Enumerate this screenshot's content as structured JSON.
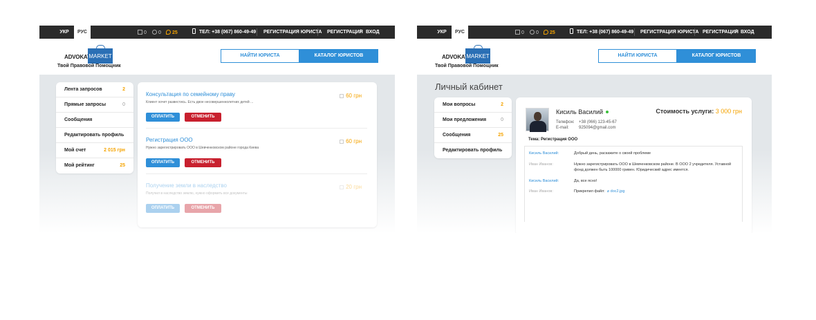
{
  "topbar": {
    "lang_uk": "УКР",
    "lang_ru": "РУС",
    "docs_count": "0",
    "warn_count": "0",
    "msg_count": "25",
    "phone": "ТЕЛ: +38 (067) 860-49-49",
    "register_lawyer": "РЕГИСТРАЦИЯ ЮРИСТА",
    "register": "РЕГИСТРАЦИЯ",
    "slash": "/",
    "login": "ВХОД"
  },
  "header": {
    "logo_advokat": "ADVOKAT",
    "logo_market": "MARKET",
    "tagline": "Твой Правовой Помощник",
    "find_lawyer": "НАЙТИ ЮРИСТА",
    "lawyer_catalog": "КАТАЛОГ ЮРИСТОВ"
  },
  "screen1": {
    "menu": [
      {
        "label": "Лента запросов",
        "count": "2"
      },
      {
        "label": "Прямые запросы",
        "count": "0"
      },
      {
        "label": "Сообщения",
        "count": ""
      },
      {
        "label": "Редактировать профиль",
        "count": ""
      },
      {
        "label": "Мой счет",
        "count": "2 015 грн"
      },
      {
        "label": "Мой рейтинг",
        "count": "25"
      }
    ],
    "requests": [
      {
        "title": "Консультация по семейному праву",
        "desc": "Клиент хочет развестись. Есть двое несовершеннолетних детей ...",
        "price": "60 грн",
        "pay": "ОПЛАТИТЬ",
        "cancel": "ОТМЕНИТЬ"
      },
      {
        "title": "Регистрация ООО",
        "desc": "Нужно зарегистрировать ООО в Шевченковском районе города Киева",
        "price": "60 грн",
        "pay": "ОПЛАТИТЬ",
        "cancel": "ОТМЕНИТЬ"
      },
      {
        "title": "Получение земли в наследство",
        "desc": "Получил в наследство землю, нужно оформить все документы",
        "price": "20 грн",
        "pay": "ОПЛАТИТЬ",
        "cancel": "ОТМЕНИТЬ"
      }
    ]
  },
  "screen2": {
    "page_title": "Личный кабинет",
    "menu": [
      {
        "label": "Мои вопросы",
        "count": "2"
      },
      {
        "label": "Мои предложения",
        "count": "0"
      },
      {
        "label": "Сообщения",
        "count": "25"
      },
      {
        "label": "Редактировать профиль",
        "count": ""
      }
    ],
    "profile": {
      "name": "Кисиль Василий",
      "phone_label": "Телефон:",
      "phone": "+38 (066) 123-45-67",
      "email_label": "E-mail:",
      "email": "925094@gmail.com",
      "cost_label": "Стоимость услуги:",
      "cost_value": "3 000 грн",
      "topic": "Тема: Регистрация ООО"
    },
    "messages": [
      {
        "author": "Кисиль Василий:",
        "text": "Добрый день, раскажите о своей проблеме"
      },
      {
        "author": "Иван Иванов:",
        "text": "Нужно зарегистрировать ООО в Шевченковском районе. В ООО 2 учредителя. Уставной фонд должен быть 100000 гривен. Юридический адрес имеется."
      },
      {
        "author": "Кисиль Василий:",
        "text": "Да, все ясно!"
      },
      {
        "author": "Иван Иванов:",
        "text": "Прикрепил файл:",
        "attachment": "doc2.jpg"
      }
    ]
  },
  "colors": {
    "accent": "#2f8fd8",
    "danger": "#c8202e",
    "highlight": "#f5a300",
    "topbar": "#2b2b2b"
  }
}
